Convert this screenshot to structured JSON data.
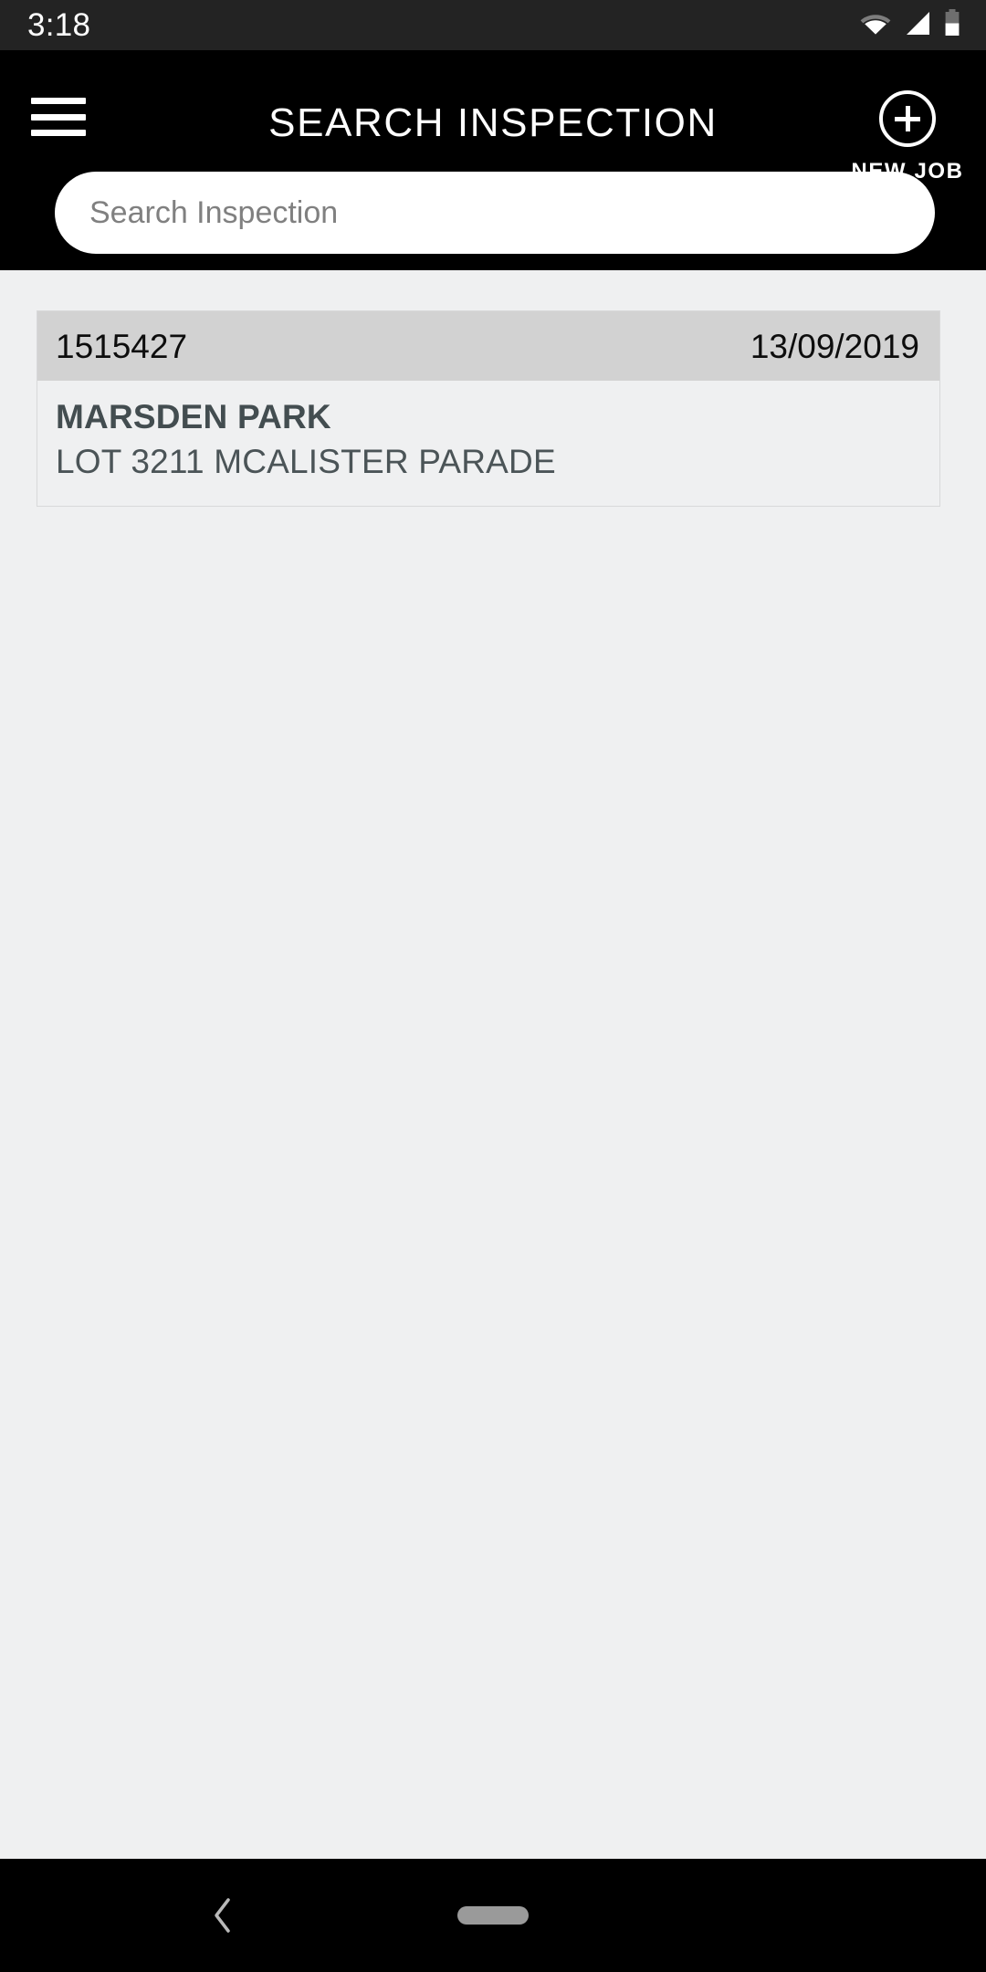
{
  "status_bar": {
    "time": "3:18",
    "icons": [
      "wifi-icon",
      "cellular-signal-icon",
      "battery-icon"
    ]
  },
  "app_bar": {
    "menu_icon": "hamburger-menu-icon",
    "title": "SEARCH INSPECTION",
    "new_job": {
      "icon": "plus-circle-icon",
      "label": "NEW JOB"
    }
  },
  "search": {
    "placeholder": "Search Inspection",
    "value": ""
  },
  "results": [
    {
      "id": "1515427",
      "date": "13/09/2019",
      "suburb": "MARSDEN PARK",
      "address": "LOT 3211 MCALISTER PARADE"
    }
  ],
  "nav_bar": {
    "back_icon": "chevron-left-icon",
    "home_pill": "home-pill-handle"
  },
  "colors": {
    "status_bar_bg": "#232323",
    "app_bar_bg": "#000000",
    "page_bg": "#eff0f1",
    "card_header_bg": "#d2d2d2",
    "card_text": "#434d50",
    "placeholder": "#808080"
  }
}
